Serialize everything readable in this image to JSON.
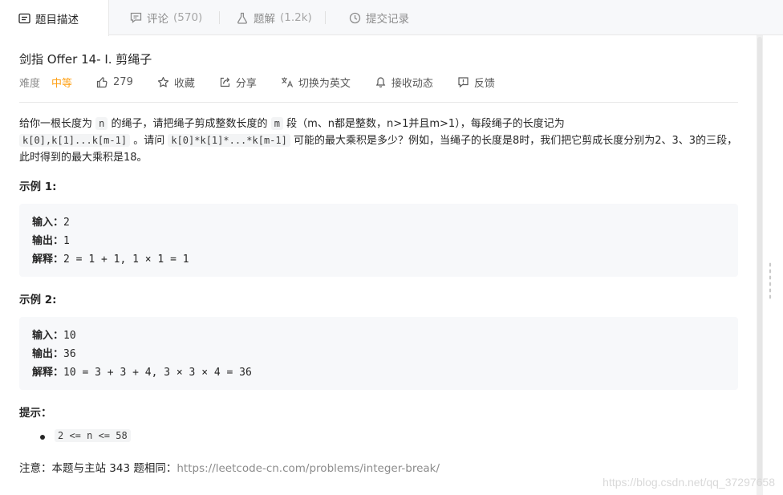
{
  "tabs": [
    {
      "label": "题目描述",
      "count": "",
      "icon": "description-icon"
    },
    {
      "label": "评论",
      "count": "(570)",
      "icon": "comment-icon"
    },
    {
      "label": "题解",
      "count": "(1.2k)",
      "icon": "flask-icon"
    },
    {
      "label": "提交记录",
      "count": "",
      "icon": "clock-icon"
    }
  ],
  "problem": {
    "title": "剑指 Offer 14- I. 剪绳子",
    "difficulty_label": "难度",
    "difficulty": "中等",
    "likes": "279",
    "favorite": "收藏",
    "share": "分享",
    "translate": "切换为英文",
    "follow": "接收动态",
    "feedback": "反馈"
  },
  "description": {
    "p1": "给你一根长度为",
    "code_n": "n",
    "p2": "的绳子，请把绳子剪成整数长度的",
    "code_m": "m",
    "p3": "段（m、n都是整数，n>1并且m>1），每段绳子的长度记为",
    "code_k": "k[0],k[1]...k[m-1]",
    "p4": "。请问",
    "code_prod": "k[0]*k[1]*...*k[m-1]",
    "p5": "可能的最大乘积是多少？例如，当绳子的长度是8时，我们把它剪成长度分别为2、3、3的三段，此时得到的最大乘积是18。"
  },
  "examples": [
    {
      "title": "示例 1:",
      "input_label": "输入：",
      "input": "2",
      "output_label": "输出：",
      "output": "1",
      "explain_label": "解释：",
      "explain": "2 = 1 + 1, 1 × 1 = 1"
    },
    {
      "title": "示例 2:",
      "input_label": "输入：",
      "input": "10",
      "output_label": "输出：",
      "output": "36",
      "explain_label": "解释：",
      "explain": "10 = 3 + 3 + 4, 3 × 3 × 4 = 36"
    }
  ],
  "hints": {
    "title": "提示：",
    "items": [
      "2 <= n <= 58"
    ]
  },
  "note": {
    "text": "注意：本题与主站 343 题相同：",
    "link": "https://leetcode-cn.com/problems/integer-break/"
  },
  "watermark": "https://blog.csdn.net/qq_37297658",
  "colors": {
    "accent": "#ffa116",
    "link": "#8c8c8c"
  }
}
